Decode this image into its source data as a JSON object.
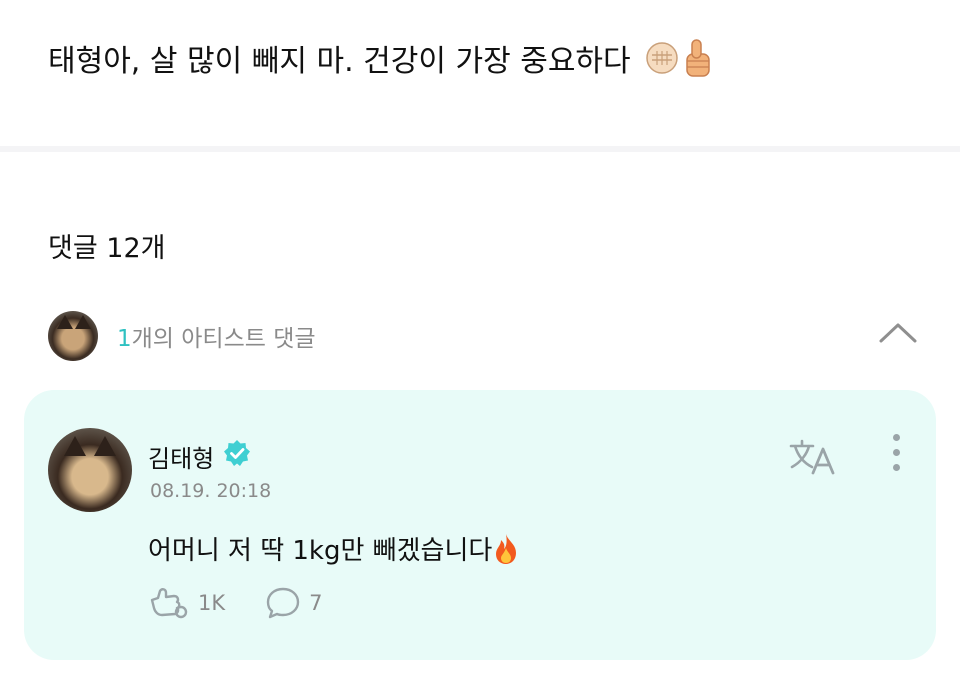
{
  "post": {
    "text": "태형아, 살 많이 빼지 마.  건강이 가장 중요하다",
    "emojis": [
      "fist-emoji",
      "thumbs-up-emoji"
    ]
  },
  "comments": {
    "count_label": "댓글 12개",
    "artist_section": {
      "count": "1",
      "label": "개의 아티스트 댓글",
      "expanded": true
    },
    "items": [
      {
        "author": "김태형",
        "verified": true,
        "timestamp": "08.19. 20:18",
        "body": "어머니 저 딱 1kg만 빼겠습니다",
        "body_emoji": "fire-emoji",
        "likes": "1K",
        "replies": "7"
      }
    ]
  },
  "colors": {
    "accent": "#2fc1c1",
    "card_background": "#e8fbf8",
    "muted_text": "#8a8a8a",
    "icon_gray": "#9aa4a8"
  },
  "icons": {
    "collapse": "chevron-up-icon",
    "translate": "translate-icon",
    "more": "more-vertical-icon",
    "like": "like-hand-icon",
    "reply": "speech-bubble-icon",
    "verified": "verified-badge-icon"
  }
}
